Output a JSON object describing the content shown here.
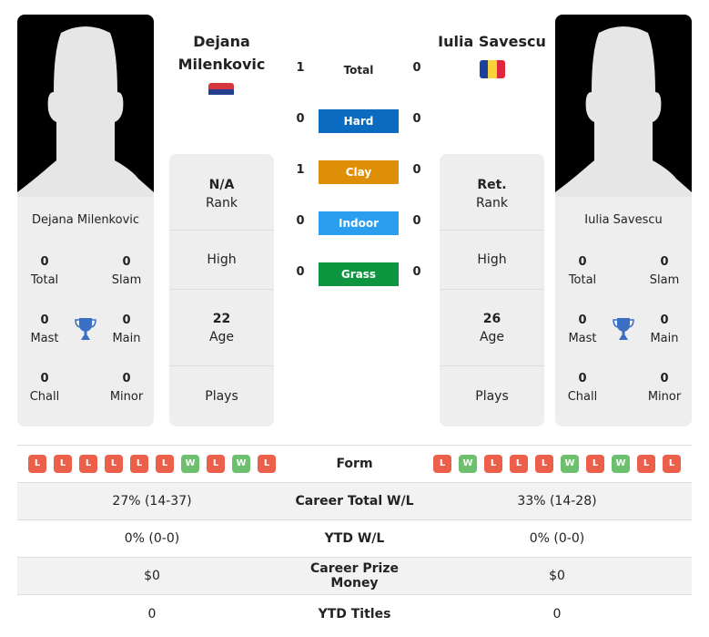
{
  "player1": {
    "name": "Dejana Milenkovic",
    "title_line1": "Dejana",
    "title_line2": "Milenkovic",
    "flag": "serbia-flag",
    "titles": {
      "total": {
        "value": "0",
        "label": "Total"
      },
      "slam": {
        "value": "0",
        "label": "Slam"
      },
      "mast": {
        "value": "0",
        "label": "Mast"
      },
      "main": {
        "value": "0",
        "label": "Main"
      },
      "chall": {
        "value": "0",
        "label": "Chall"
      },
      "minor": {
        "value": "0",
        "label": "Minor"
      }
    },
    "info": {
      "rank_value": "N/A",
      "rank_label": "Rank",
      "high_label": "High",
      "age_value": "22",
      "age_label": "Age",
      "plays_label": "Plays"
    }
  },
  "player2": {
    "name": "Iulia Savescu",
    "flag": "romania-flag",
    "titles": {
      "total": {
        "value": "0",
        "label": "Total"
      },
      "slam": {
        "value": "0",
        "label": "Slam"
      },
      "mast": {
        "value": "0",
        "label": "Mast"
      },
      "main": {
        "value": "0",
        "label": "Main"
      },
      "chall": {
        "value": "0",
        "label": "Chall"
      },
      "minor": {
        "value": "0",
        "label": "Minor"
      }
    },
    "info": {
      "rank_value": "Ret.",
      "rank_label": "Rank",
      "high_label": "High",
      "age_value": "26",
      "age_label": "Age",
      "plays_label": "Plays"
    }
  },
  "h2h": [
    {
      "label": "Total",
      "p1": "1",
      "p2": "0",
      "color": "transparent"
    },
    {
      "label": "Hard",
      "p1": "0",
      "p2": "0",
      "color": "#0b6bc1"
    },
    {
      "label": "Clay",
      "p1": "1",
      "p2": "0",
      "color": "#de8e07"
    },
    {
      "label": "Indoor",
      "p1": "0",
      "p2": "0",
      "color": "#2b9ef0"
    },
    {
      "label": "Grass",
      "p1": "0",
      "p2": "0",
      "color": "#0d9540"
    }
  ],
  "comparison": {
    "form_label": "Form",
    "p1_form": [
      "L",
      "L",
      "L",
      "L",
      "L",
      "L",
      "W",
      "L",
      "W",
      "L"
    ],
    "p2_form": [
      "L",
      "W",
      "L",
      "L",
      "L",
      "W",
      "L",
      "W",
      "L",
      "L"
    ],
    "rows": [
      {
        "label": "Career Total W/L",
        "p1": "27% (14-37)",
        "p2": "33% (14-28)"
      },
      {
        "label": "YTD W/L",
        "p1": "0% (0-0)",
        "p2": "0% (0-0)"
      },
      {
        "label": "Career Prize Money",
        "p1": "$0",
        "p2": "$0"
      },
      {
        "label": "YTD Titles",
        "p1": "0",
        "p2": "0"
      }
    ]
  },
  "colors": {
    "loss": "#ec5f4b",
    "win": "#6cbf6c",
    "trophy": "#3a6fc4"
  }
}
